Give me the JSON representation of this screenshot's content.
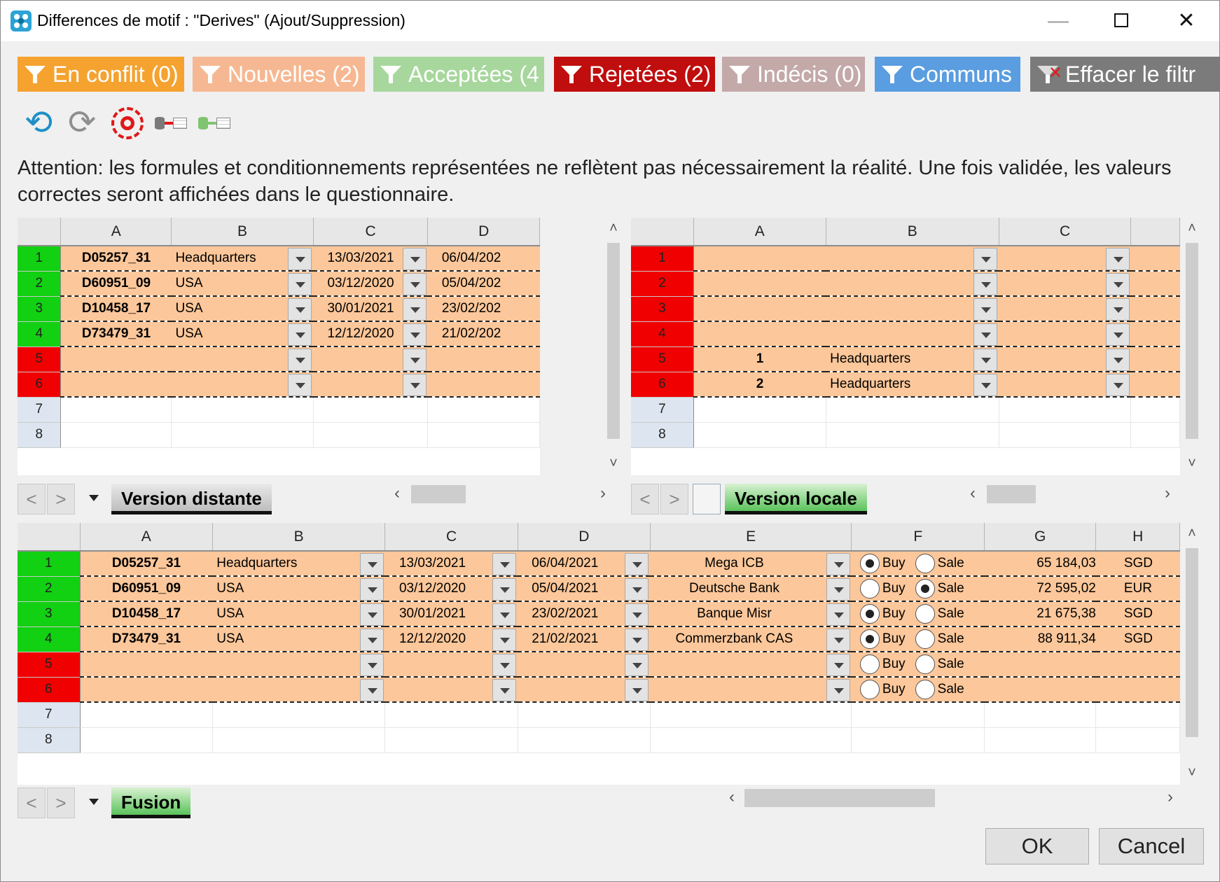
{
  "window": {
    "title": "Differences de motif : \"Derives\" (Ajout/Suppression)",
    "min": "—",
    "close": "✕"
  },
  "filters": [
    {
      "label": "En conflit (0)",
      "color": "#f5a22f"
    },
    {
      "label": "Nouvelles (2)",
      "color": "#f6b892"
    },
    {
      "label": "Acceptées (4",
      "color": "#a7d79d"
    },
    {
      "label": "Rejetées (2)",
      "color": "#c00d0d"
    },
    {
      "label": "Indécis (0)",
      "color": "#c4a9a9"
    },
    {
      "label": "Communs",
      "color": "#5a9de0"
    },
    {
      "label": "Effacer le filtr",
      "color": "#7b7b7b"
    }
  ],
  "toolbar": {
    "undo": "⟲",
    "redo": "⟳"
  },
  "notice": "Attention: les formules et conditionnements représentées ne reflètent pas nécessairement la réalité. Une fois validée, les valeurs correctes seront affichées dans le questionnaire.",
  "remote": {
    "tab": "Version distante",
    "columns": [
      "A",
      "B",
      "C",
      "D"
    ],
    "rows": [
      {
        "num": "1",
        "a": "D05257_31",
        "b": "Headquarters",
        "c": "13/03/2021",
        "d": "06/04/202"
      },
      {
        "num": "2",
        "a": "D60951_09",
        "b": "USA",
        "c": "03/12/2020",
        "d": "05/04/202"
      },
      {
        "num": "3",
        "a": "D10458_17",
        "b": "USA",
        "c": "30/01/2021",
        "d": "23/02/202"
      },
      {
        "num": "4",
        "a": "D73479_31",
        "b": "USA",
        "c": "12/12/2020",
        "d": "21/02/202"
      },
      {
        "num": "5",
        "a": "",
        "b": "",
        "c": "",
        "d": ""
      },
      {
        "num": "6",
        "a": "",
        "b": "",
        "c": "",
        "d": ""
      }
    ],
    "empty_rows": [
      "7",
      "8"
    ]
  },
  "local": {
    "tab": "Version locale",
    "columns": [
      "A",
      "B",
      "C"
    ],
    "rows": [
      {
        "num": "1",
        "a": "",
        "b": ""
      },
      {
        "num": "2",
        "a": "",
        "b": ""
      },
      {
        "num": "3",
        "a": "",
        "b": ""
      },
      {
        "num": "4",
        "a": "",
        "b": ""
      },
      {
        "num": "5",
        "a": "1",
        "b": "Headquarters"
      },
      {
        "num": "6",
        "a": "2",
        "b": "Headquarters"
      }
    ],
    "empty_rows": [
      "7",
      "8"
    ]
  },
  "merge": {
    "tab": "Fusion",
    "columns": [
      "A",
      "B",
      "C",
      "D",
      "E",
      "F",
      "G",
      "H"
    ],
    "buy_label": "Buy",
    "sale_label": "Sale",
    "rows": [
      {
        "num": "1",
        "a": "D05257_31",
        "b": "Headquarters",
        "c": "13/03/2021",
        "d": "06/04/2021",
        "e": "Mega ICB",
        "choice": "buy",
        "g": "65 184,03",
        "h": "SGD"
      },
      {
        "num": "2",
        "a": "D60951_09",
        "b": "USA",
        "c": "03/12/2020",
        "d": "05/04/2021",
        "e": "Deutsche Bank",
        "choice": "sale",
        "g": "72 595,02",
        "h": "EUR"
      },
      {
        "num": "3",
        "a": "D10458_17",
        "b": "USA",
        "c": "30/01/2021",
        "d": "23/02/2021",
        "e": "Banque Misr",
        "choice": "buy",
        "g": "21 675,38",
        "h": "SGD"
      },
      {
        "num": "4",
        "a": "D73479_31",
        "b": "USA",
        "c": "12/12/2020",
        "d": "21/02/2021",
        "e": "Commerzbank CAS",
        "choice": "buy",
        "g": "88 911,34",
        "h": "SGD"
      },
      {
        "num": "5",
        "a": "",
        "b": "",
        "c": "",
        "d": "",
        "e": "",
        "choice": "none",
        "g": "",
        "h": ""
      },
      {
        "num": "6",
        "a": "",
        "b": "",
        "c": "",
        "d": "",
        "e": "",
        "choice": "none",
        "g": "",
        "h": ""
      }
    ],
    "empty_rows": [
      "7",
      "8"
    ]
  },
  "nav": {
    "prev": "<",
    "next": ">",
    "scroll_left": "‹",
    "scroll_right": "›",
    "scroll_up": "˄",
    "scroll_down": "˅"
  },
  "buttons": {
    "ok": "OK",
    "cancel": "Cancel"
  },
  "row_status": {
    "1": "accepted",
    "2": "accepted",
    "3": "accepted",
    "4": "accepted",
    "5": "rejected",
    "6": "rejected"
  }
}
